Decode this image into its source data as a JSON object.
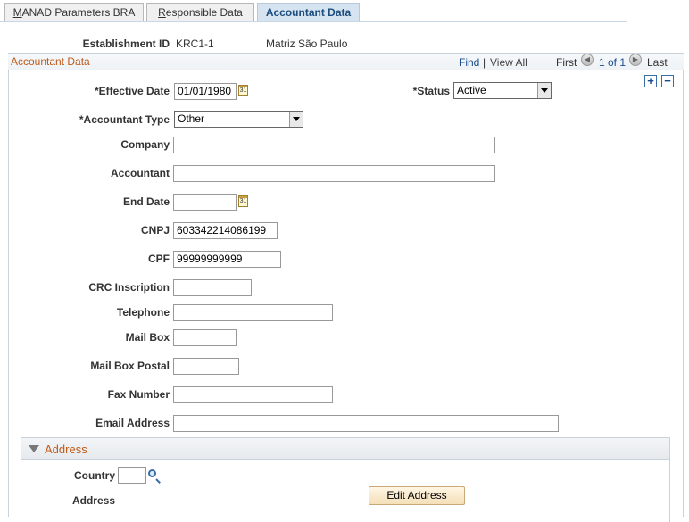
{
  "tabs": [
    {
      "label_first": "M",
      "label_rest": "ANAD Parameters BRA"
    },
    {
      "label_first": "R",
      "label_rest": "esponsible Data"
    },
    {
      "label": "Accountant Data"
    }
  ],
  "establishment": {
    "label": "Establishment ID",
    "id": "KRC1-1",
    "name": "Matriz São Paulo"
  },
  "section": {
    "title": "Accountant Data",
    "find": "Find",
    "sep": "|",
    "view_all": "View All",
    "first": "First",
    "count": "1 of 1",
    "last": "Last"
  },
  "form": {
    "effective_date": {
      "label": "*Effective Date",
      "value": "01/01/1980"
    },
    "status": {
      "label": "*Status",
      "value": "Active"
    },
    "accountant_type": {
      "label": "*Accountant Type",
      "value": "Other"
    },
    "company": {
      "label": "Company",
      "value": ""
    },
    "accountant": {
      "label": "Accountant",
      "value": ""
    },
    "end_date": {
      "label": "End Date",
      "value": ""
    },
    "cnpj": {
      "label": "CNPJ",
      "value": "603342214086199"
    },
    "cpf": {
      "label": "CPF",
      "value": "99999999999"
    },
    "crc": {
      "label": "CRC Inscription",
      "value": ""
    },
    "telephone": {
      "label": "Telephone",
      "value": ""
    },
    "mail_box": {
      "label": "Mail Box",
      "value": ""
    },
    "mail_box_postal": {
      "label": "Mail Box Postal",
      "value": ""
    },
    "fax": {
      "label": "Fax Number",
      "value": ""
    },
    "email": {
      "label": "Email Address",
      "value": ""
    }
  },
  "address": {
    "title": "Address",
    "country_label": "Country",
    "country_value": "",
    "address_label": "Address",
    "edit_button": "Edit Address"
  },
  "icons": {
    "calendar": "calendar-icon",
    "lookup": "lookup-icon",
    "add": "+",
    "delete": "−",
    "prev": "◀",
    "next": "▶",
    "cal_text": "31"
  }
}
